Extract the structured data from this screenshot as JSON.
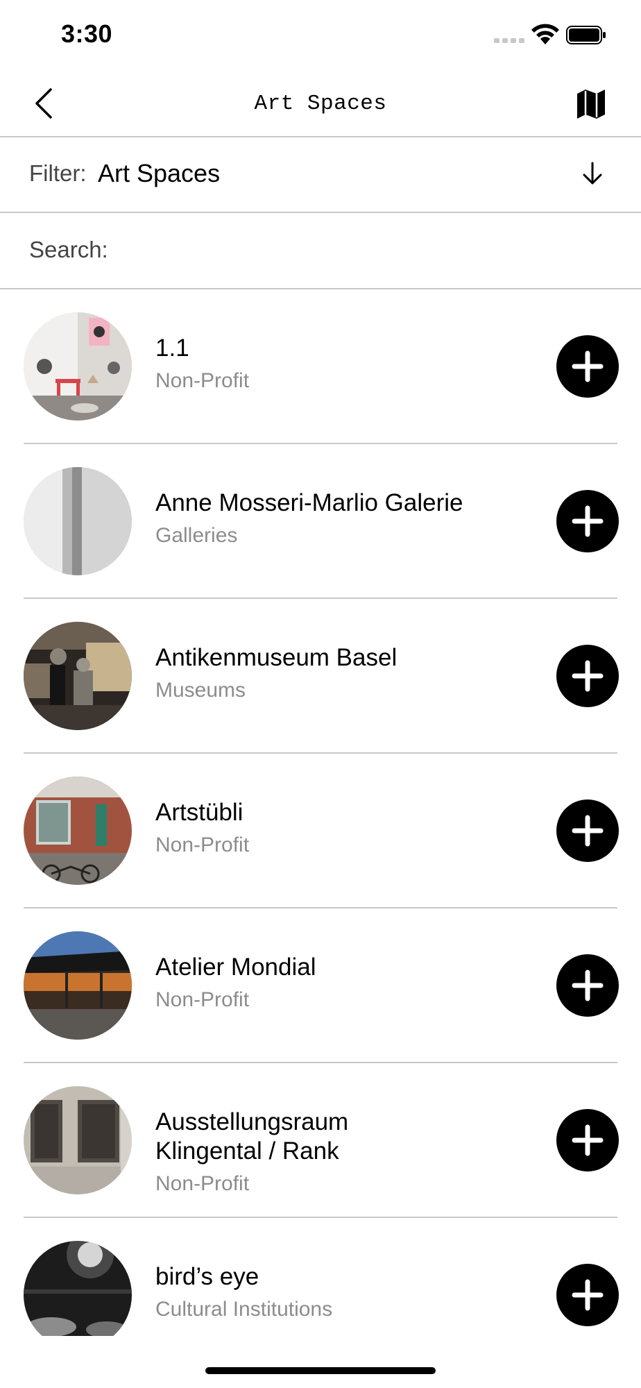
{
  "status_bar": {
    "time": "3:30"
  },
  "nav": {
    "title": "Art Spaces"
  },
  "filter": {
    "label": "Filter:",
    "value": "Art Spaces"
  },
  "search": {
    "label": "Search:",
    "value": "",
    "placeholder": ""
  },
  "items": [
    {
      "name": "1.1",
      "category": "Non-Profit"
    },
    {
      "name": "Anne Mosseri-Marlio Galerie",
      "category": "Galleries"
    },
    {
      "name": "Antikenmuseum Basel",
      "category": "Museums"
    },
    {
      "name": "Artstübli",
      "category": "Non-Profit"
    },
    {
      "name": "Atelier Mondial",
      "category": "Non-Profit"
    },
    {
      "name": "Ausstellungsraum Klingental / Rank",
      "category": "Non-Profit"
    },
    {
      "name": "bird’s eye",
      "category": "Cultural Institutions"
    }
  ]
}
